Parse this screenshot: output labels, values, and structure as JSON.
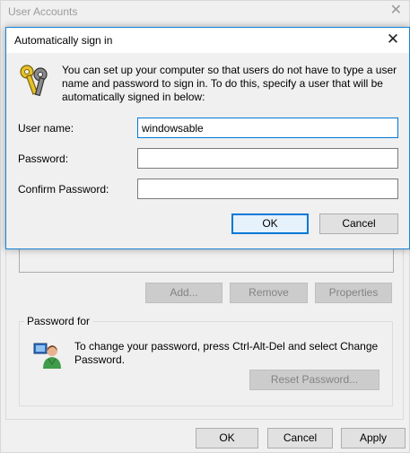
{
  "parent_window": {
    "title": "User Accounts",
    "buttons": {
      "add": "Add...",
      "remove": "Remove",
      "properties": "Properties",
      "reset_password": "Reset Password...",
      "ok": "OK",
      "cancel": "Cancel",
      "apply": "Apply"
    },
    "password_group": {
      "legend": "Password for",
      "text": "To change your password, press Ctrl-Alt-Del and select Change Password."
    }
  },
  "dialog": {
    "title": "Automatically sign in",
    "description": "You can set up your computer so that users do not have to type a user name and password to sign in. To do this, specify a user that will be automatically signed in below:",
    "fields": {
      "username": {
        "label": "User name:",
        "value": "windowsable"
      },
      "password": {
        "label": "Password:",
        "value": ""
      },
      "confirm": {
        "label": "Confirm Password:",
        "value": ""
      }
    },
    "ok_label": "OK",
    "cancel_label": "Cancel"
  },
  "icons": {
    "keys": "keys-icon",
    "user": "user-icon",
    "close": "close-icon"
  },
  "colors": {
    "accent": "#0078d7",
    "window_bg": "#f0f0f0",
    "disabled_text": "#838383"
  }
}
